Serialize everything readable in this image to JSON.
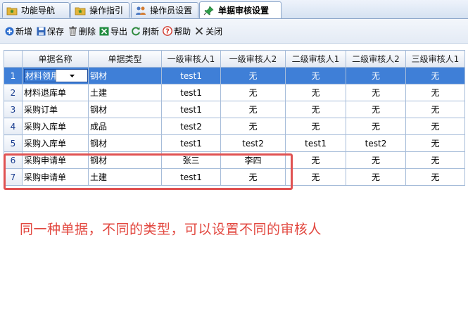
{
  "tabs": [
    {
      "label": "功能导航",
      "icon": "folder-star-icon",
      "active": false
    },
    {
      "label": "操作指引",
      "icon": "folder-star-icon",
      "active": false
    },
    {
      "label": "操作员设置",
      "icon": "users-icon",
      "active": false
    },
    {
      "label": "单据审核设置",
      "icon": "pushpin-icon",
      "active": true
    }
  ],
  "toolbar": {
    "add": "新增",
    "save": "保存",
    "delete": "删除",
    "export": "导出",
    "refresh": "刷新",
    "help": "帮助",
    "close": "关闭"
  },
  "table": {
    "columns": [
      "单据名称",
      "单据类型",
      "一级审核人1",
      "一级审核人2",
      "二级审核人1",
      "二级审核人2",
      "三级审核人1"
    ],
    "rows": [
      {
        "no": "1",
        "cells": [
          "材料领用出库单",
          "钢材",
          "test1",
          "无",
          "无",
          "无",
          "无"
        ]
      },
      {
        "no": "2",
        "cells": [
          "材料退库单",
          "土建",
          "test1",
          "无",
          "无",
          "无",
          "无"
        ]
      },
      {
        "no": "3",
        "cells": [
          "采购订单",
          "钢材",
          "test1",
          "无",
          "无",
          "无",
          "无"
        ]
      },
      {
        "no": "4",
        "cells": [
          "采购入库单",
          "成品",
          "test2",
          "无",
          "无",
          "无",
          "无"
        ]
      },
      {
        "no": "5",
        "cells": [
          "采购入库单",
          "钢材",
          "test1",
          "test2",
          "test1",
          "test2",
          "无"
        ]
      },
      {
        "no": "6",
        "cells": [
          "采购申请单",
          "钢材",
          "张三",
          "李四",
          "无",
          "无",
          "无"
        ]
      },
      {
        "no": "7",
        "cells": [
          "采购申请单",
          "土建",
          "test1",
          "无",
          "无",
          "无",
          "无"
        ]
      }
    ]
  },
  "annotation": "同一种单据，不同的类型，可以设置不同的审核人",
  "colors": {
    "selected_row": "#3f7fd7",
    "highlight_box": "#e05252",
    "annotation_text": "#e2473f"
  }
}
